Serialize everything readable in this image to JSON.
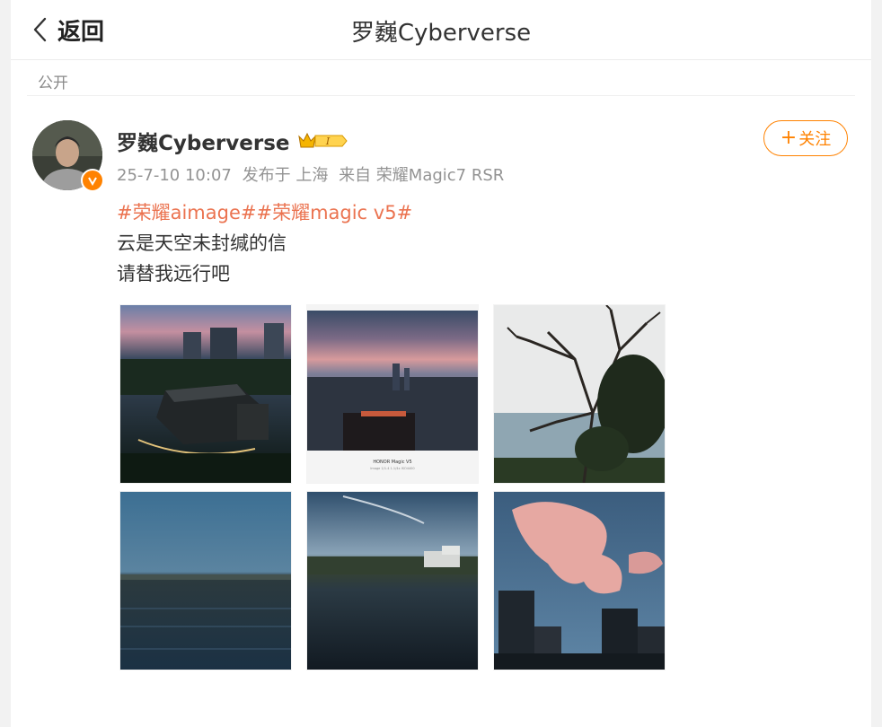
{
  "header": {
    "back_label": "返回",
    "title": "罗巍Cyberverse"
  },
  "post": {
    "visibility": "公开",
    "author": {
      "name": "罗巍Cyberverse",
      "level_badge": "I",
      "verified_icon": "verified-v-icon",
      "crown_icon": "crown-icon"
    },
    "meta": {
      "time": "25-7-10 10:07",
      "location": "发布于 上海",
      "device": "来自 荣耀Magic7 RSR"
    },
    "follow_label": "关注",
    "tags": "#荣耀aimage##荣耀magic v5#",
    "lines": [
      "云是天空未封缄的信",
      "请替我远行吧"
    ],
    "photo_caption_text": "HONOR Magic V5",
    "photo_caption_sub": "Image 1/1.4 1.1/4x ISO4400"
  },
  "colors": {
    "accent": "#ff8200",
    "tag": "#eb7350",
    "text": "#333333",
    "meta": "#939393"
  }
}
